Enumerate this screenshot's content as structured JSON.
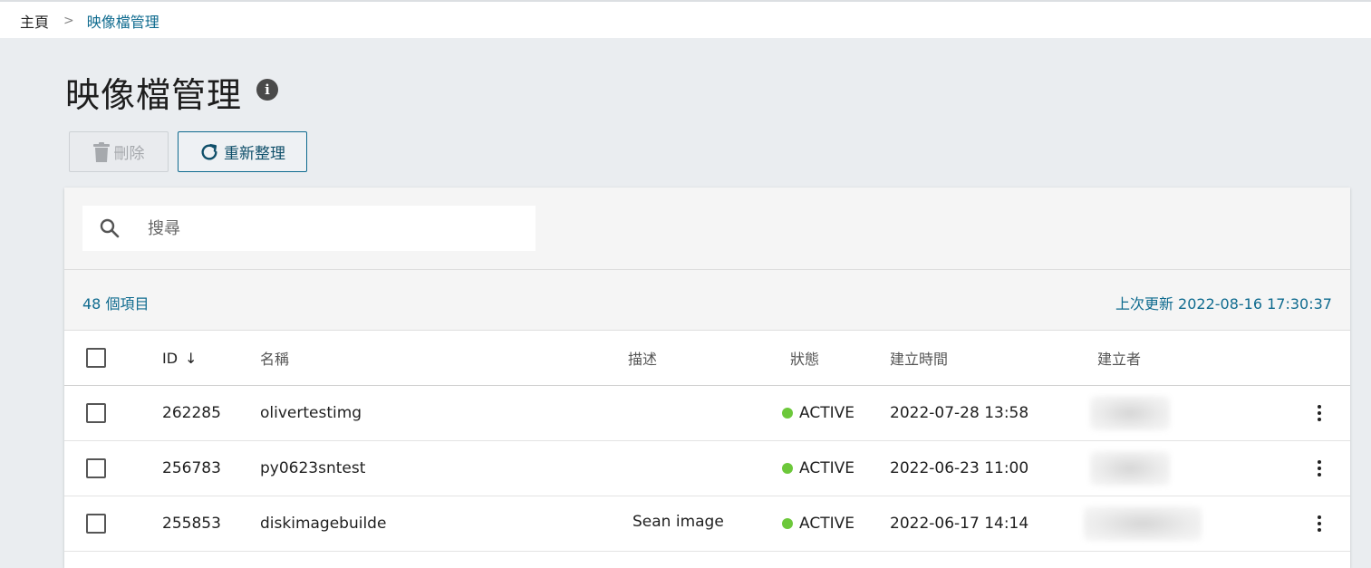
{
  "breadcrumb": {
    "home": "主頁",
    "separator": ">",
    "current": "映像檔管理"
  },
  "page": {
    "title": "映像檔管理"
  },
  "toolbar": {
    "delete_label": "刪除",
    "refresh_label": "重新整理"
  },
  "search": {
    "placeholder": "搜尋",
    "value": ""
  },
  "summary": {
    "count_text": "48 個項目",
    "updated_text": "上次更新 2022-08-16 17:30:37"
  },
  "table": {
    "columns": {
      "id": "ID",
      "name": "名稱",
      "description": "描述",
      "status": "狀態",
      "created_at": "建立時間",
      "creator": "建立者"
    },
    "sort_indicator": "↓",
    "rows": [
      {
        "id": "262285",
        "name": "olivertestimg",
        "description": "",
        "status": "ACTIVE",
        "created_at": "2022-07-28 13:58"
      },
      {
        "id": "256783",
        "name": "py0623sntest",
        "description": "",
        "status": "ACTIVE",
        "created_at": "2022-06-23 11:00"
      },
      {
        "id": "255853",
        "name": "diskimagebuilde",
        "description": "Sean image",
        "status": "ACTIVE",
        "created_at": "2022-06-17 14:14"
      }
    ]
  },
  "colors": {
    "accent": "#0f6b8f",
    "status_active": "#6cc83a",
    "background": "#eaedf0"
  },
  "icons": {
    "info": "info-icon",
    "delete": "trash-icon",
    "refresh": "refresh-icon",
    "search": "search-icon",
    "menu": "kebab-menu-icon"
  }
}
